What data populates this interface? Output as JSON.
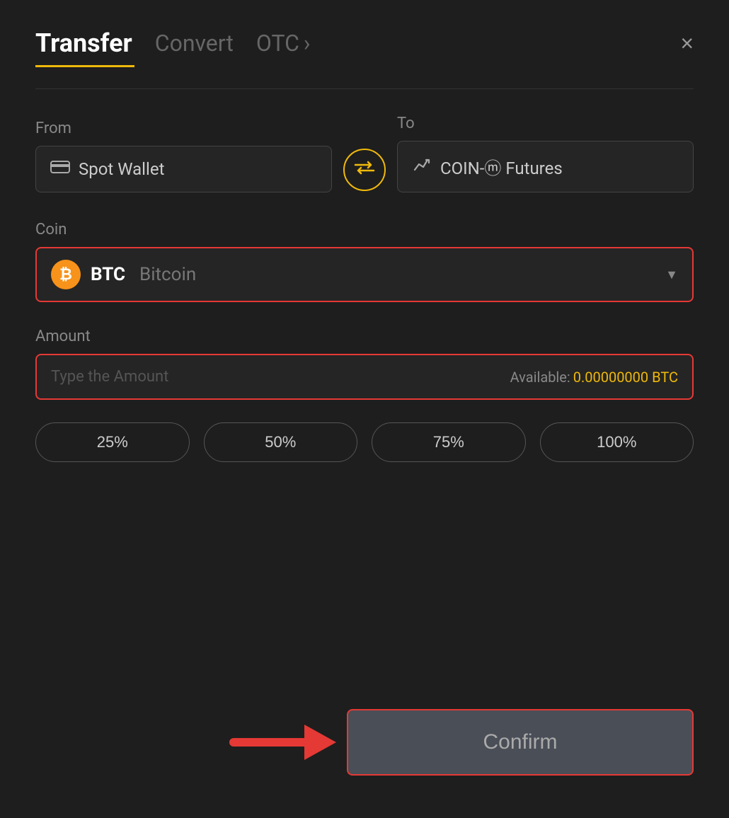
{
  "header": {
    "tab_transfer": "Transfer",
    "tab_convert": "Convert",
    "tab_otc": "OTC",
    "tab_otc_chevron": "›",
    "close_label": "×"
  },
  "from_field": {
    "label": "From",
    "wallet_icon": "🪪",
    "wallet_name": "Spot Wallet"
  },
  "to_field": {
    "label": "To",
    "wallet_icon": "↑",
    "wallet_name": "COIN-ⓜ Futures"
  },
  "swap_icon": "⇄",
  "coin_section": {
    "label": "Coin",
    "coin_ticker": "BTC",
    "coin_name": "Bitcoin"
  },
  "amount_section": {
    "label": "Amount",
    "placeholder": "Type the Amount",
    "available_label": "Available:",
    "available_value": "0.00000000 BTC"
  },
  "pct_buttons": [
    "25%",
    "50%",
    "75%",
    "100%"
  ],
  "confirm_button": {
    "label": "Confirm"
  },
  "colors": {
    "accent_yellow": "#f0b90b",
    "accent_red": "#e53935",
    "bg_dark": "#1e1e1e",
    "bg_card": "#252525"
  }
}
